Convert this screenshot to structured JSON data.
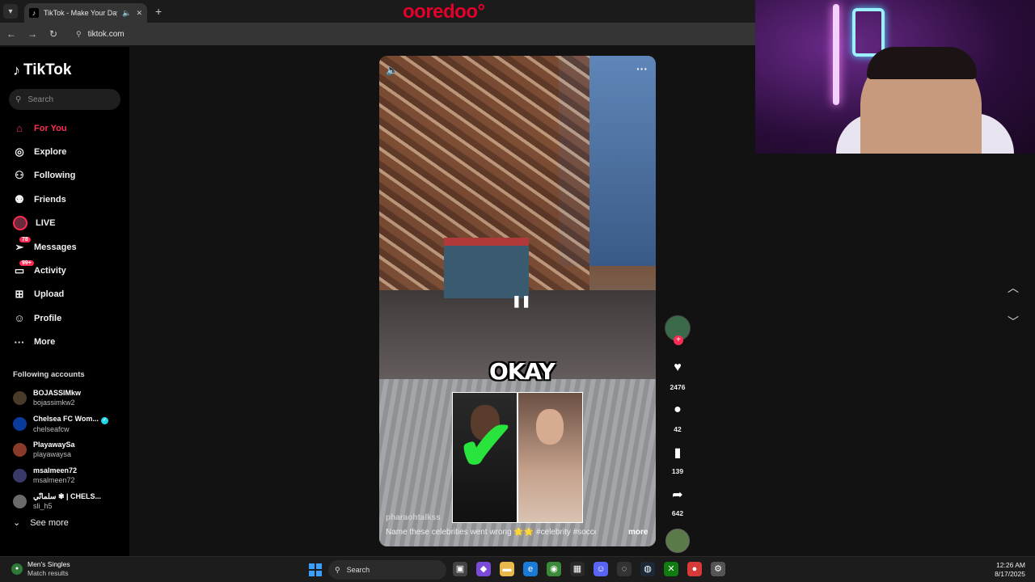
{
  "browser": {
    "tab_title": "TikTok - Make Your Day",
    "new_tab": "+",
    "url": "tiktok.com"
  },
  "overlay_brand": "ooredoo°",
  "tiktok": {
    "logo_text": "TikTok",
    "search_placeholder": "Search",
    "nav": [
      {
        "label": "For You",
        "icon": "home-icon",
        "active": true
      },
      {
        "label": "Explore",
        "icon": "compass-icon"
      },
      {
        "label": "Following",
        "icon": "following-icon"
      },
      {
        "label": "Friends",
        "icon": "friends-icon"
      },
      {
        "label": "LIVE",
        "icon": "live-avatar-icon"
      },
      {
        "label": "Messages",
        "icon": "messages-icon",
        "badge": "78"
      },
      {
        "label": "Activity",
        "icon": "activity-icon",
        "badge": "99+"
      },
      {
        "label": "Upload",
        "icon": "upload-icon"
      },
      {
        "label": "Profile",
        "icon": "profile-icon"
      },
      {
        "label": "More",
        "icon": "more-icon"
      }
    ],
    "following_header": "Following accounts",
    "accounts": [
      {
        "name": "BOJASSIMkw",
        "handle": "bojassimkw2",
        "color": "#4a3a2a"
      },
      {
        "name": "Chelsea FC Wom...",
        "handle": "chelseafcw",
        "verified": true,
        "color": "#0a3a9a"
      },
      {
        "name": "PlayawaySa",
        "handle": "playawaysa",
        "color": "#8a3a2a"
      },
      {
        "name": "msalmeen72",
        "handle": "msalmeen72",
        "color": "#3a3a6a"
      },
      {
        "name": "سلمانّي ✾ | CHELS...",
        "handle": "sli_h5",
        "color": "#6a6a6a"
      }
    ],
    "see_more": "See more"
  },
  "video": {
    "overlay_text": "OKAY",
    "username": "pharaohtalkss",
    "caption": "Name these celebrities went wrong 🌟🌟 #celebrity #soccer ...",
    "more": "more",
    "likes": "2476",
    "comments": "42",
    "saves": "139",
    "shares": "642"
  },
  "taskbar": {
    "widget_title": "Men's Singles",
    "widget_subtitle": "Match results",
    "search_placeholder": "Search",
    "time": "12:26 AM",
    "date": "8/17/2025"
  },
  "colors": {
    "accent": "#fe2c55",
    "brand_red": "#e4002b",
    "check_green": "#2ae43e"
  }
}
